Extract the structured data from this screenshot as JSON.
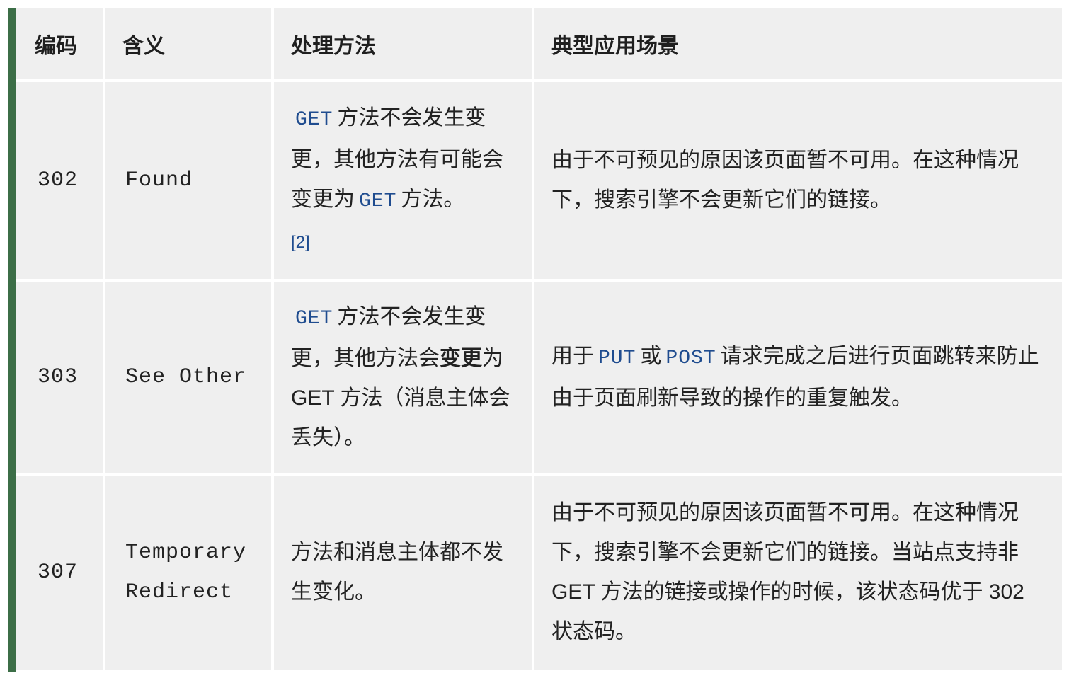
{
  "headers": {
    "code": "编码",
    "meaning": "含义",
    "method": "处理方法",
    "usage": "典型应用场景"
  },
  "rows": [
    {
      "code": "302",
      "meaning": "Found",
      "method": {
        "kw1": "GET",
        "text1": "方法不会发生变更，其他方法有可能会变更为",
        "kw2": "GET",
        "text2": "方法。",
        "ref": "[2]"
      },
      "usage": "由于不可预见的原因该页面暂不可用。在这种情况下，搜索引擎不会更新它们的链接。"
    },
    {
      "code": "303",
      "meaning": "See Other",
      "method": {
        "kw1": "GET",
        "text1": "方法不会发生变更，其他方法会",
        "bold": "变更",
        "text2": "为 GET 方法（消息主体会丢失）。"
      },
      "usage": {
        "text1": "用于",
        "kw1": "PUT",
        "text2": "或",
        "kw2": "POST",
        "text3": "请求完成之后进行页面跳转来防止由于页面刷新导致的操作的重复触发。"
      }
    },
    {
      "code": "307",
      "meaning": "Temporary Redirect",
      "method": "方法和消息主体都不发生变化。",
      "usage": "由于不可预见的原因该页面暂不可用。在这种情况下，搜索引擎不会更新它们的链接。当站点支持非 GET 方法的链接或操作的时候，该状态码优于 302 状态码。"
    }
  ],
  "colors": {
    "accent_bar": "#3c6e47",
    "cell_background": "#efefef",
    "keyword": "#1f4c8f"
  }
}
